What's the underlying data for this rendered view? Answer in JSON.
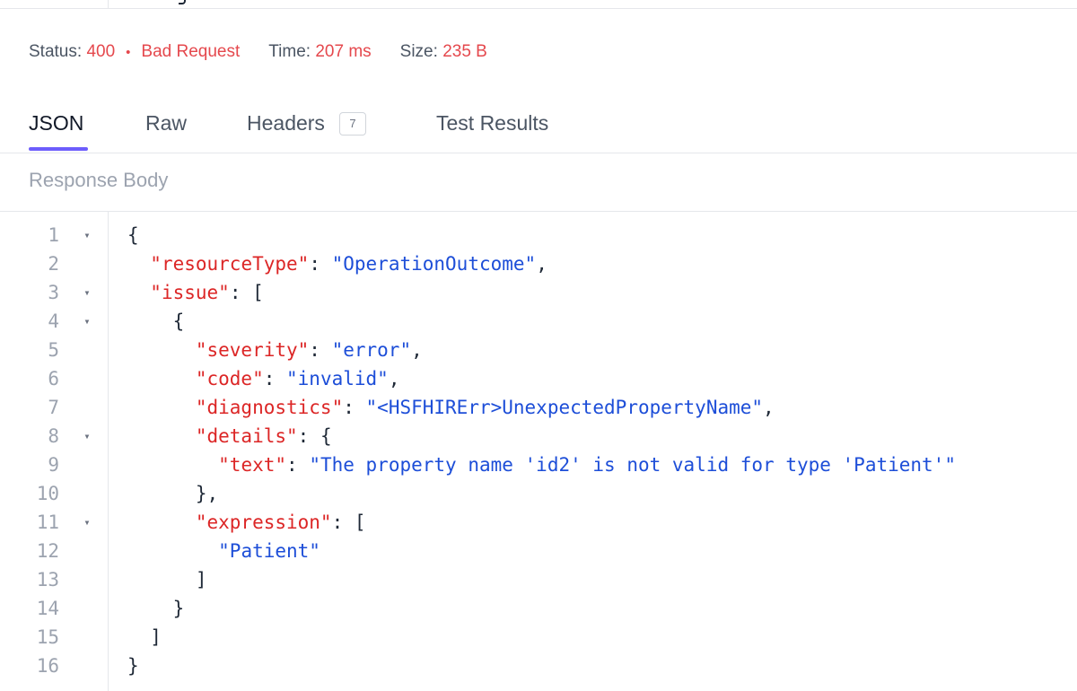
{
  "status": {
    "status_label": "Status:",
    "code": "400",
    "bullet": "•",
    "text": "Bad Request",
    "time_label": "Time:",
    "time_value": "207 ms",
    "size_label": "Size:",
    "size_value": "235 B"
  },
  "tabs": [
    {
      "label": "JSON",
      "active": true
    },
    {
      "label": "Raw"
    },
    {
      "label": "Headers",
      "badge": "7"
    },
    {
      "label": "Test Results"
    }
  ],
  "section_title": "Response Body",
  "colors": {
    "error": "#e5484d",
    "accent": "#6d5dfc",
    "json_key": "#dc2626",
    "json_string": "#1d4ed8"
  },
  "fold_icon": "▾",
  "code_lines": [
    {
      "n": "1",
      "fold": true,
      "parts": [
        {
          "t": "{",
          "c": "p"
        }
      ]
    },
    {
      "n": "2",
      "parts": [
        {
          "t": "  ",
          "c": "p"
        },
        {
          "t": "\"resourceType\"",
          "c": "k"
        },
        {
          "t": ": ",
          "c": "p"
        },
        {
          "t": "\"OperationOutcome\"",
          "c": "s"
        },
        {
          "t": ",",
          "c": "p"
        }
      ]
    },
    {
      "n": "3",
      "fold": true,
      "parts": [
        {
          "t": "  ",
          "c": "p"
        },
        {
          "t": "\"issue\"",
          "c": "k"
        },
        {
          "t": ": [",
          "c": "p"
        }
      ]
    },
    {
      "n": "4",
      "fold": true,
      "parts": [
        {
          "t": "    {",
          "c": "p"
        }
      ]
    },
    {
      "n": "5",
      "parts": [
        {
          "t": "      ",
          "c": "p"
        },
        {
          "t": "\"severity\"",
          "c": "k"
        },
        {
          "t": ": ",
          "c": "p"
        },
        {
          "t": "\"error\"",
          "c": "s"
        },
        {
          "t": ",",
          "c": "p"
        }
      ]
    },
    {
      "n": "6",
      "parts": [
        {
          "t": "      ",
          "c": "p"
        },
        {
          "t": "\"code\"",
          "c": "k"
        },
        {
          "t": ": ",
          "c": "p"
        },
        {
          "t": "\"invalid\"",
          "c": "s"
        },
        {
          "t": ",",
          "c": "p"
        }
      ]
    },
    {
      "n": "7",
      "parts": [
        {
          "t": "      ",
          "c": "p"
        },
        {
          "t": "\"diagnostics\"",
          "c": "k"
        },
        {
          "t": ": ",
          "c": "p"
        },
        {
          "t": "\"<HSFHIRErr>UnexpectedPropertyName\"",
          "c": "s"
        },
        {
          "t": ",",
          "c": "p"
        }
      ]
    },
    {
      "n": "8",
      "fold": true,
      "parts": [
        {
          "t": "      ",
          "c": "p"
        },
        {
          "t": "\"details\"",
          "c": "k"
        },
        {
          "t": ": {",
          "c": "p"
        }
      ]
    },
    {
      "n": "9",
      "parts": [
        {
          "t": "        ",
          "c": "p"
        },
        {
          "t": "\"text\"",
          "c": "k"
        },
        {
          "t": ": ",
          "c": "p"
        },
        {
          "t": "\"The property name 'id2' is not valid for type 'Patient'\"",
          "c": "s"
        }
      ]
    },
    {
      "n": "10",
      "parts": [
        {
          "t": "      },",
          "c": "p"
        }
      ]
    },
    {
      "n": "11",
      "fold": true,
      "parts": [
        {
          "t": "      ",
          "c": "p"
        },
        {
          "t": "\"expression\"",
          "c": "k"
        },
        {
          "t": ": [",
          "c": "p"
        }
      ]
    },
    {
      "n": "12",
      "parts": [
        {
          "t": "        ",
          "c": "p"
        },
        {
          "t": "\"Patient\"",
          "c": "s"
        }
      ]
    },
    {
      "n": "13",
      "parts": [
        {
          "t": "      ]",
          "c": "p"
        }
      ]
    },
    {
      "n": "14",
      "parts": [
        {
          "t": "    }",
          "c": "p"
        }
      ]
    },
    {
      "n": "15",
      "parts": [
        {
          "t": "  ]",
          "c": "p"
        }
      ]
    },
    {
      "n": "16",
      "parts": [
        {
          "t": "}",
          "c": "p"
        }
      ]
    }
  ]
}
